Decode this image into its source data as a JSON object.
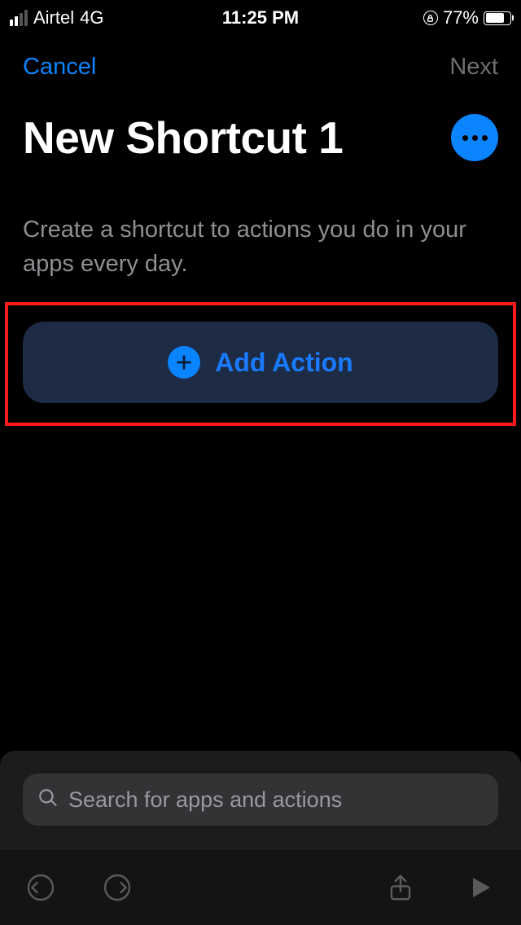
{
  "status_bar": {
    "carrier": "Airtel",
    "network_type": "4G",
    "time": "11:25 PM",
    "battery_percent": "77%"
  },
  "nav": {
    "cancel_label": "Cancel",
    "next_label": "Next"
  },
  "title": "New Shortcut 1",
  "description": "Create a shortcut to actions you do in your apps every day.",
  "add_action_label": "Add Action",
  "search": {
    "placeholder": "Search for apps and actions"
  }
}
